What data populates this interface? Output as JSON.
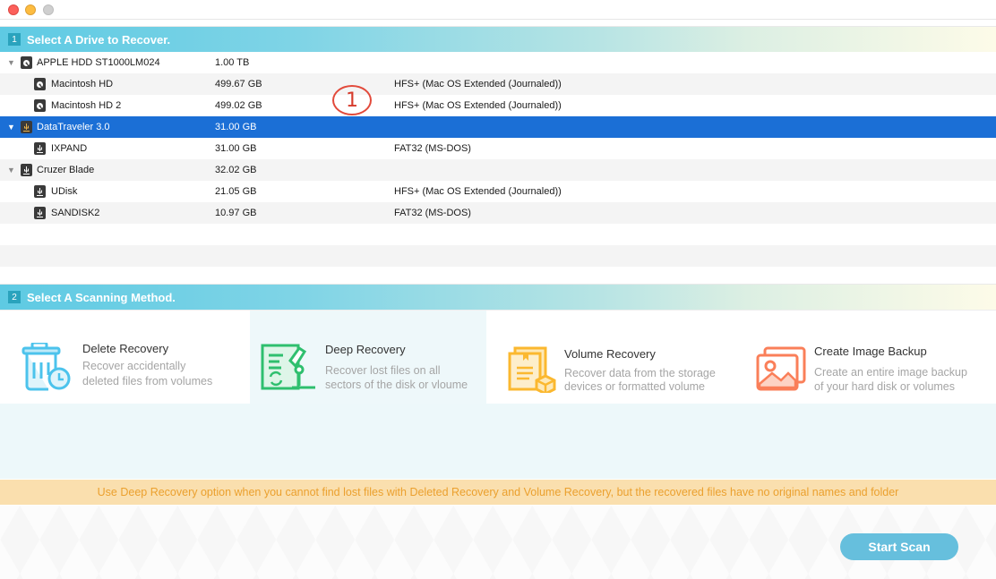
{
  "window": {
    "controls": [
      "close",
      "minimize",
      "maximize"
    ]
  },
  "step1": {
    "number": "1",
    "title": "Select A Drive to Recover."
  },
  "drives": [
    {
      "level": 0,
      "expanded": true,
      "icon": "hard-drive-icon",
      "name": "APPLE HDD ST1000LM024",
      "size": "1.00 TB",
      "fs": "",
      "selected": false
    },
    {
      "level": 1,
      "icon": "hard-drive-icon",
      "name": "Macintosh HD",
      "size": "499.67 GB",
      "fs": "HFS+ (Mac OS Extended (Journaled))",
      "selected": false
    },
    {
      "level": 1,
      "icon": "hard-drive-icon",
      "name": "Macintosh HD 2",
      "size": "499.02 GB",
      "fs": "HFS+ (Mac OS Extended (Journaled))",
      "selected": false
    },
    {
      "level": 0,
      "expanded": true,
      "icon": "usb-drive-icon",
      "name": "DataTraveler 3.0",
      "size": "31.00 GB",
      "fs": "",
      "selected": true
    },
    {
      "level": 1,
      "icon": "usb-drive-icon",
      "name": "IXPAND",
      "size": "31.00 GB",
      "fs": "FAT32 (MS-DOS)",
      "selected": false
    },
    {
      "level": 0,
      "expanded": true,
      "icon": "usb-drive-icon",
      "name": "Cruzer Blade",
      "size": "32.02 GB",
      "fs": "",
      "selected": false
    },
    {
      "level": 1,
      "icon": "usb-drive-icon",
      "name": "UDisk",
      "size": "21.05 GB",
      "fs": "HFS+ (Mac OS Extended (Journaled))",
      "selected": false
    },
    {
      "level": 1,
      "icon": "usb-drive-icon",
      "name": "SANDISK2",
      "size": "10.97 GB",
      "fs": "FAT32 (MS-DOS)",
      "selected": false
    }
  ],
  "annotation": {
    "label": "1",
    "color": "#e24a3b"
  },
  "step2": {
    "number": "2",
    "title": "Select A Scanning Method."
  },
  "methods": [
    {
      "id": "delete",
      "title": "Delete Recovery",
      "desc1": "Recover accidentally",
      "desc2": "deleted files from volumes",
      "color": "#4cc3ec",
      "active": false
    },
    {
      "id": "deep",
      "title": "Deep Recovery",
      "desc1": "Recover lost files on all",
      "desc2": "sectors of the disk or vloume",
      "color": "#2fbf6e",
      "active": true
    },
    {
      "id": "volume",
      "title": "Volume Recovery",
      "desc1": "Recover data from the storage",
      "desc2": "devices or formatted volume",
      "color": "#fbb82f",
      "active": false
    },
    {
      "id": "image",
      "title": "Create Image Backup",
      "desc1": "Create an entire image backup",
      "desc2": "of your hard disk or volumes",
      "color": "#fa7f59",
      "active": false
    }
  ],
  "notice": "Use Deep Recovery option when you cannot find lost files with Deleted Recovery and Volume Recovery, but the recovered files have no original names and folder",
  "start_scan_label": "Start Scan",
  "colors": {
    "selection": "#1b6fd6",
    "header_start": "#5ecae3",
    "button": "#66bfdd",
    "notice_bg": "#fadfae",
    "notice_text": "#eba02e"
  }
}
